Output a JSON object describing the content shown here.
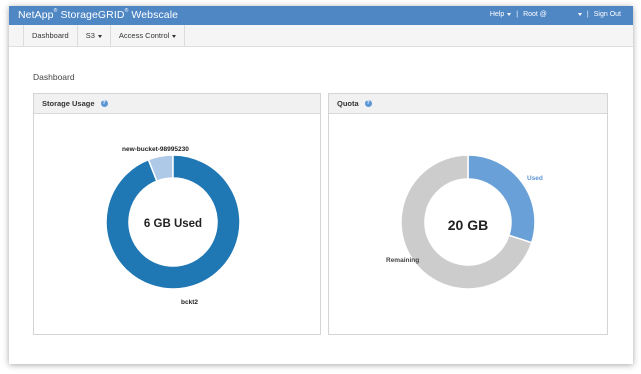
{
  "app": {
    "brand_main": "NetApp",
    "brand_sup1": "®",
    "brand_product": " StorageGRID",
    "brand_sup2": "®",
    "brand_tail": " Webscale"
  },
  "topbar": {
    "help_label": "Help",
    "user_label": "Root @",
    "signout_label": "Sign Out",
    "separator": "|"
  },
  "nav": {
    "items": [
      {
        "label": "Dashboard",
        "has_caret": false
      },
      {
        "label": "S3",
        "has_caret": true
      },
      {
        "label": "Access Control",
        "has_caret": true
      }
    ]
  },
  "page": {
    "title": "Dashboard"
  },
  "panels": {
    "storage": {
      "title": "Storage Usage",
      "help_icon": "?"
    },
    "quota": {
      "title": "Quota",
      "help_icon": "?"
    }
  },
  "chart_data": [
    {
      "type": "pie",
      "title": "Storage Usage",
      "center_label": "6 GB Used",
      "slices": [
        {
          "label": "new-bucket-98995230",
          "value": 6,
          "color": "#aec8e8"
        },
        {
          "label": "bckt2",
          "value": 94,
          "color": "#1f77b4"
        }
      ]
    },
    {
      "type": "pie",
      "title": "Quota",
      "center_label": "20 GB",
      "slices": [
        {
          "label": "Used",
          "value": 30,
          "color": "#6aa0d8"
        },
        {
          "label": "Remaining",
          "value": 70,
          "color": "#cccccc"
        }
      ]
    }
  ],
  "colors": {
    "topbar": "#4f87c5",
    "accent": "#5b95d6"
  }
}
